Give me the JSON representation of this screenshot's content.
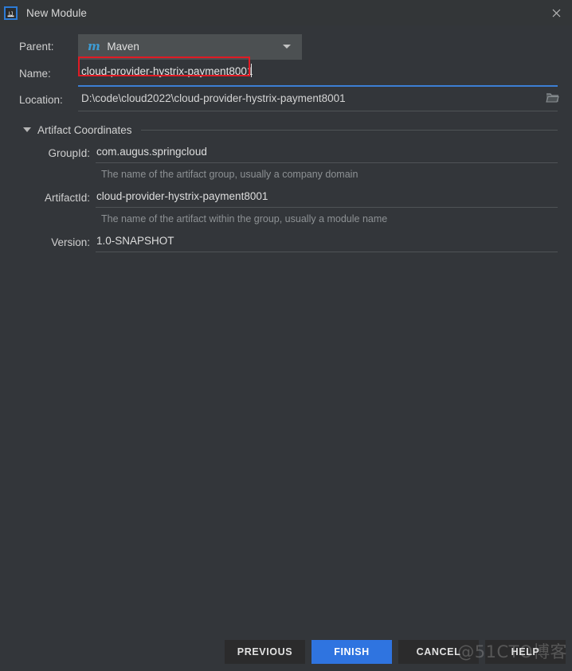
{
  "window": {
    "title": "New Module",
    "app_icon": "intellij-idea-icon",
    "close_icon": "close-icon"
  },
  "form": {
    "parent": {
      "label": "Parent:",
      "value": "Maven",
      "logo_text": "m",
      "logo_color": "#3d9cd4",
      "dropdown_icon": "chevron-down-icon"
    },
    "name": {
      "label": "Name:",
      "value": "cloud-provider-hystrix-payment8001",
      "focused": true,
      "highlight_color": "#e01b24",
      "focus_color": "#3c7fd4"
    },
    "location": {
      "label": "Location:",
      "value": "D:\\code\\cloud2022\\cloud-provider-hystrix-payment8001",
      "browse_icon": "folder-icon"
    }
  },
  "artifact_section": {
    "title": "Artifact Coordinates",
    "expanded": true,
    "toggle_icon": "triangle-down-icon",
    "fields": [
      {
        "label": "GroupId:",
        "value": "com.augus.springcloud",
        "hint": "The name of the artifact group, usually a company domain"
      },
      {
        "label": "ArtifactId:",
        "value": "cloud-provider-hystrix-payment8001",
        "hint": "The name of the artifact within the group, usually a module name"
      },
      {
        "label": "Version:",
        "value": "1.0-SNAPSHOT",
        "hint": ""
      }
    ]
  },
  "footer": {
    "buttons": [
      {
        "label": "PREVIOUS",
        "primary": false
      },
      {
        "label": "FINISH",
        "primary": true
      },
      {
        "label": "CANCEL",
        "primary": false
      },
      {
        "label": "HELP",
        "primary": false
      }
    ],
    "primary_color": "#2f74e0"
  },
  "watermark": {
    "text": "@51CTO博客"
  }
}
